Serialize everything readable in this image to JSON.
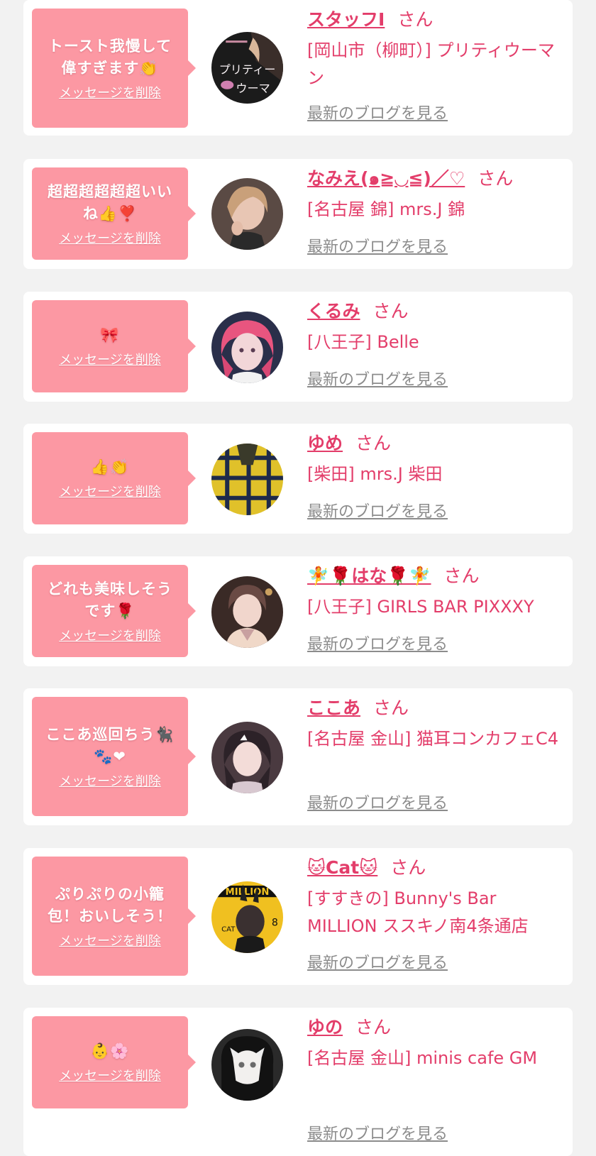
{
  "common": {
    "san": "さん",
    "delete_label": "メッセージを削除",
    "blog_link": "最新のブログを見る"
  },
  "colors": {
    "page_bg": "#f2f2f2",
    "card_bg": "#ffffff",
    "bubble_bg": "#fc98a3",
    "name_pink": "#e33d6a",
    "link_gray": "#8c8c8c"
  },
  "items": [
    {
      "message": "トースト我慢して偉すぎます👏",
      "name": "スタッフI",
      "shop": "[岡山市（柳町）] プリティウーマン",
      "avatar": "store-logo-avatar"
    },
    {
      "message": "超超超超超超いいね👍❣️",
      "name": "なみえ(๑≧◡≦)／♡",
      "shop": "[名古屋 錦] mrs.J 錦",
      "avatar": "girl-photo-avatar"
    },
    {
      "message": "🎀",
      "name": "くるみ",
      "shop": "[八王子] Belle",
      "avatar": "pink-hair-avatar"
    },
    {
      "message": "👍👏",
      "name": "ゆめ",
      "shop": "[柴田] mrs.J 柴田",
      "avatar": "plaid-shirt-avatar"
    },
    {
      "message": "どれも美味しそうです🌹",
      "name": "🧚🌹はな🌹🧚",
      "shop": "[八王子] GIRLS BAR PIXXXY",
      "avatar": "girl-photo-avatar"
    },
    {
      "message": "ここあ巡回ちう🐈‍⬛🐾❤",
      "name": "ここあ",
      "shop": "[名古屋 金山] 猫耳コンカフェC4",
      "avatar": "girl-photo-avatar"
    },
    {
      "message": "ぷりぷりの小籠包！おいしそう！",
      "name": "🐱Cat🐱",
      "shop": "[すすきの] Bunny's Bar MILLION ススキノ南4条通店",
      "avatar": "magazine-cover-avatar"
    },
    {
      "message": "👶🌸",
      "name": "ゆの",
      "shop": "[名古屋 金山] minis cafe GM",
      "avatar": "masked-girl-avatar"
    }
  ]
}
